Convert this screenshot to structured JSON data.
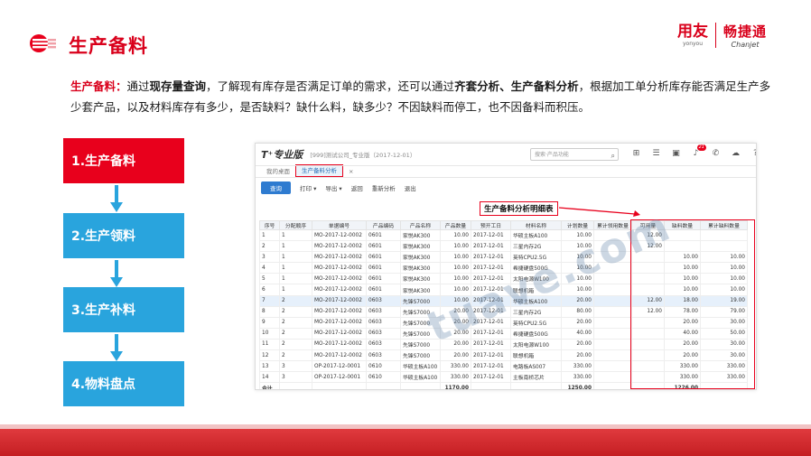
{
  "header": {
    "title": "生产备料",
    "logo_icon": "circle-stripes-icon",
    "brand_yonyou": "用友",
    "brand_yonyou_sub": "yonyou",
    "brand_chanjet": "畅捷通",
    "brand_chanjet_sub": "Chanjet"
  },
  "description": {
    "label": "生产备料：",
    "p1": "通过",
    "b1": "现存量查询",
    "p2": "，了解现有库存是否满足订单的需求，还可以通过",
    "b2": "齐套分析、生产备料分析",
    "p3": "，根据加工单分析库存能否满足生产多少套产品，以及材料库存有多少，是否缺料？缺什么料，缺多少？不因缺料而停工，也不因备料而积压。"
  },
  "steps": [
    {
      "label": "1.生产备料"
    },
    {
      "label": "2.生产领料"
    },
    {
      "label": "3.生产补料"
    },
    {
      "label": "4.物料盘点"
    }
  ],
  "app": {
    "logo": "T⁺专业版",
    "company": "[999]测试公司_专业版（2017-12-01）",
    "search_placeholder": "搜索·产品功能",
    "notification_count": "21",
    "tabs": [
      {
        "label": "我的桌面"
      },
      {
        "label": "生产备料分析"
      }
    ],
    "toolbar": {
      "query": "查询",
      "print": "打印",
      "export": "导出",
      "back": "返回",
      "redesign": "重新分析",
      "exit": "退出"
    },
    "report_title": "生产备料分析明细表",
    "columns": [
      "序号",
      "分配顺序",
      "单据编号",
      "产品编码",
      "产品名称",
      "产品数量",
      "预开工日",
      "材料名称",
      "计划数量",
      "累计领用数量",
      "可用量",
      "缺料数量",
      "累计缺料数量"
    ],
    "rows": [
      [
        "1",
        "1",
        "MO-2017-12-0002",
        "0601",
        "家悦AK300",
        "10.00",
        "2017-12-01",
        "华硕主板A100",
        "10.00",
        "",
        "12.00",
        "",
        ""
      ],
      [
        "2",
        "1",
        "MO-2017-12-0002",
        "0601",
        "家悦AK300",
        "10.00",
        "2017-12-01",
        "三星内存2G",
        "10.00",
        "",
        "12.00",
        "",
        ""
      ],
      [
        "3",
        "1",
        "MO-2017-12-0002",
        "0601",
        "家悦AK300",
        "10.00",
        "2017-12-01",
        "英特CPU2.5G",
        "10.00",
        "",
        "",
        "10.00",
        "10.00"
      ],
      [
        "4",
        "1",
        "MO-2017-12-0002",
        "0601",
        "家悦AK300",
        "10.00",
        "2017-12-01",
        "希捷硬盘500G",
        "10.00",
        "",
        "",
        "10.00",
        "10.00"
      ],
      [
        "5",
        "1",
        "MO-2017-12-0002",
        "0601",
        "家悦AK300",
        "10.00",
        "2017-12-01",
        "太阳电源W100",
        "10.00",
        "",
        "",
        "10.00",
        "10.00"
      ],
      [
        "6",
        "1",
        "MO-2017-12-0002",
        "0601",
        "家悦AK300",
        "10.00",
        "2017-12-01",
        "联想机箱",
        "10.00",
        "",
        "",
        "10.00",
        "10.00"
      ],
      [
        "7",
        "2",
        "MO-2017-12-0002",
        "0603",
        "先锋S7000",
        "10.00",
        "2017-12-01",
        "华硕主板A100",
        "20.00",
        "",
        "12.00",
        "18.00",
        "19.00"
      ],
      [
        "8",
        "2",
        "MO-2017-12-0002",
        "0603",
        "先锋S7000",
        "20.00",
        "2017-12-01",
        "三星内存2G",
        "80.00",
        "",
        "12.00",
        "78.00",
        "79.00"
      ],
      [
        "9",
        "2",
        "MO-2017-12-0002",
        "0603",
        "先锋S7000",
        "20.00",
        "2017-12-01",
        "英特CPU2.5G",
        "20.00",
        "",
        "",
        "20.00",
        "30.00"
      ],
      [
        "10",
        "2",
        "MO-2017-12-0002",
        "0603",
        "先锋S7000",
        "20.00",
        "2017-12-01",
        "希捷硬盘500G",
        "40.00",
        "",
        "",
        "40.00",
        "50.00"
      ],
      [
        "11",
        "2",
        "MO-2017-12-0002",
        "0603",
        "先锋S7000",
        "20.00",
        "2017-12-01",
        "太阳电源W100",
        "20.00",
        "",
        "",
        "20.00",
        "30.00"
      ],
      [
        "12",
        "2",
        "MO-2017-12-0002",
        "0603",
        "先锋S7000",
        "20.00",
        "2017-12-01",
        "联想机箱",
        "20.00",
        "",
        "",
        "20.00",
        "30.00"
      ],
      [
        "13",
        "3",
        "OP-2017-12-0001",
        "0610",
        "华硕主板A100",
        "330.00",
        "2017-12-01",
        "电路板AS007",
        "330.00",
        "",
        "",
        "330.00",
        "330.00"
      ],
      [
        "14",
        "3",
        "OP-2017-12-0001",
        "0610",
        "华硕主板A100",
        "330.00",
        "2017-12-01",
        "主板南桥芯片",
        "330.00",
        "",
        "",
        "330.00",
        "330.00"
      ]
    ],
    "total": {
      "label": "合计",
      "product_qty": "1170.00",
      "plan_qty": "1250.00",
      "shortage": "1226.00"
    },
    "cell_tooltip": "10.00"
  },
  "watermark": "tuave.com",
  "colors": {
    "accent": "#d9001b",
    "step_blue": "#29a4dd",
    "step_active": "#e8001c",
    "query_btn": "#2e7bd0"
  }
}
